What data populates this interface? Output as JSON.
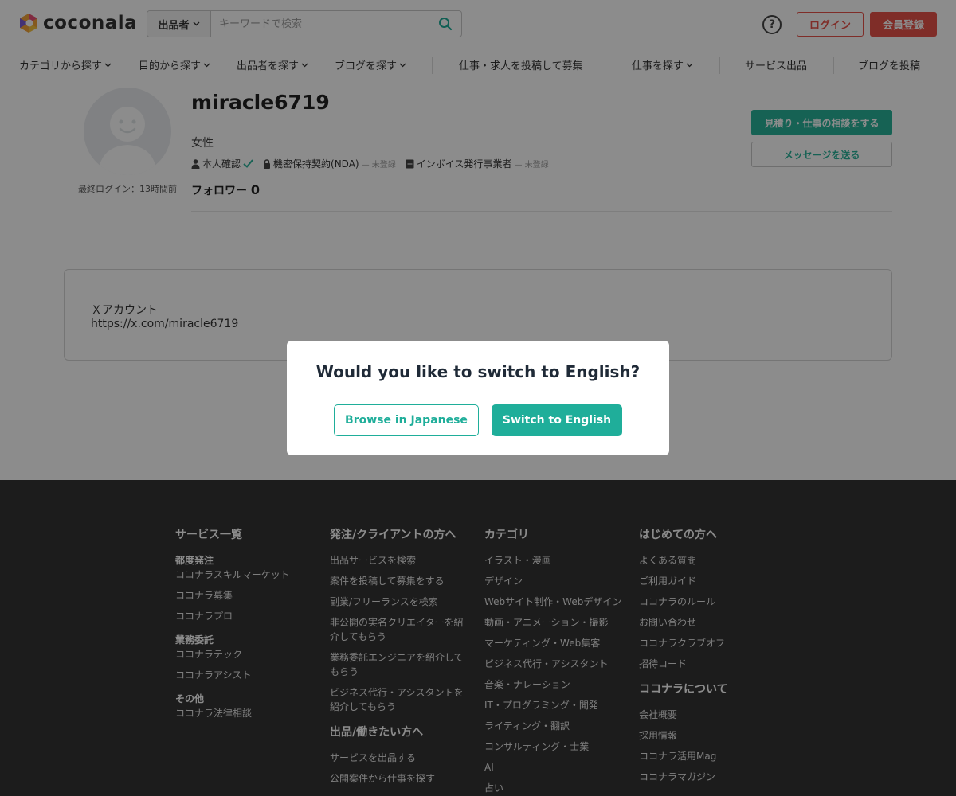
{
  "header": {
    "logo_text": "coconala",
    "search_category": "出品者",
    "search_placeholder": "キーワードで検索",
    "help_glyph": "?",
    "login_label": "ログイン",
    "signup_label": "会員登録"
  },
  "nav": {
    "items": [
      "カテゴリから探す",
      "目的から探す",
      "出品者を探す",
      "ブログを探す",
      "仕事・求人を投稿して募集",
      "仕事を探す",
      "サービス出品",
      "ブログを投稿"
    ]
  },
  "profile": {
    "username": "miracle6719",
    "gender": "女性",
    "identity_label": "本人確認",
    "nda_label": "機密保持契約(NDA)",
    "nda_status": "— 未登録",
    "invoice_label": "インボイス発行事業者",
    "invoice_status": "— 未登録",
    "followers_label": "フォロワー",
    "followers_count": "0",
    "last_login": "最終ログイン：13時間前",
    "consult_button": "見積り・仕事の相談をする",
    "message_button": "メッセージを送る"
  },
  "account": {
    "label": "Ｘアカウント",
    "url": "https://x.com/miracle6719"
  },
  "modal": {
    "title": "Would you like to switch to English?",
    "browse_japanese": "Browse in Japanese",
    "switch_english": "Switch to English"
  },
  "footer": {
    "services": {
      "heading": "サービス一覧",
      "sub1": "都度発注",
      "links1": [
        "ココナラスキルマーケット",
        "ココナラ募集",
        "ココナラプロ"
      ],
      "sub2": "業務委託",
      "links2": [
        "ココナラテック",
        "ココナラアシスト"
      ],
      "sub3": "その他",
      "links3": [
        "ココナラ法律相談"
      ]
    },
    "clients": {
      "heading": "発注/クライアントの方へ",
      "links": [
        "出品サービスを検索",
        "案件を投稿して募集をする",
        "副業/フリーランスを検索",
        "非公開の実名クリエイターを紹介してもらう",
        "業務委託エンジニアを紹介してもらう",
        "ビジネス代行・アシスタントを紹介してもらう"
      ],
      "heading2": "出品/働きたい方へ",
      "links2": [
        "サービスを出品する",
        "公開案件から仕事を探す"
      ]
    },
    "categories": {
      "heading": "カテゴリ",
      "links": [
        "イラスト・漫画",
        "デザイン",
        "Webサイト制作・Webデザイン",
        "動画・アニメーション・撮影",
        "マーケティング・Web集客",
        "ビジネス代行・アシスタント",
        "音楽・ナレーション",
        "IT・プログラミング・開発",
        "ライティング・翻訳",
        "コンサルティング・士業",
        "AI",
        "占い"
      ]
    },
    "beginners": {
      "heading": "はじめての方へ",
      "links": [
        "よくある質問",
        "ご利用ガイド",
        "ココナラのルール",
        "お問い合わせ",
        "ココナラクラブオフ",
        "招待コード"
      ],
      "heading2": "ココナラについて",
      "links2": [
        "会社概要",
        "採用情報",
        "ココナラ活用Mag",
        "ココナラマガジン"
      ]
    }
  },
  "colors": {
    "brand_red": "#e8524a",
    "teal": "#1fae9a",
    "footer_bg": "#333333"
  }
}
